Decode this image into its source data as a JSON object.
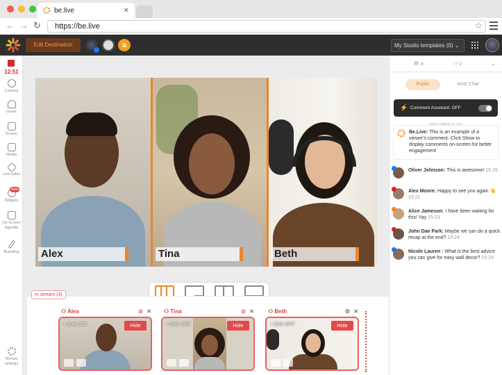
{
  "browser": {
    "tab_title": "be.live",
    "tab_close": "✕",
    "url": "https://be.live",
    "dots": [
      "#ef5b57",
      "#f6bd2f",
      "#3ec743"
    ]
  },
  "header": {
    "edit_destination": "Edit Destination",
    "studio_templates": "My Studio templates (0) ⌄",
    "accent": "#e8872d"
  },
  "sidebar": {
    "clock": "12:51",
    "items": [
      {
        "label": "Camera",
        "icon": "camera-icon"
      },
      {
        "label": "Guest",
        "icon": "guest-icon"
      },
      {
        "label": "Screen",
        "icon": "screen-icon"
      },
      {
        "label": "Media",
        "icon": "media-icon"
      },
      {
        "label": "Live Sales",
        "icon": "tag-icon"
      },
      {
        "label": "Widgets",
        "icon": "widgets-icon",
        "badge": "New"
      },
      {
        "label": "On Screen Agenda",
        "icon": "agenda-icon"
      },
      {
        "label": "Branding",
        "icon": "brush-icon"
      },
      {
        "label": "Stream settings",
        "icon": "gear-icon"
      }
    ]
  },
  "stage": {
    "cams": [
      {
        "name": "Alex"
      },
      {
        "name": "Tina"
      },
      {
        "name": "Beth"
      }
    ]
  },
  "backstage": {
    "instream": "In stream (3)",
    "guests": [
      {
        "name": "Alex",
        "solo": "• Solo OFF",
        "hide": "Hide"
      },
      {
        "name": "Tina",
        "solo": "• Solo OFF",
        "hide": "Hide"
      },
      {
        "name": "Beth",
        "solo": "• Solo OFF",
        "hide": "Hide"
      }
    ]
  },
  "panel": {
    "viewers": "👁 4",
    "guests": "⚇ 2",
    "tab_public": "Public",
    "tab_host": "Host Chat",
    "assistant": "Comment Assistant: OFF",
    "only_visible": "ONLY VISIBLE TO YOU",
    "belive_name": "Be.Live:",
    "belive_text": "This is an example of a viewer's comment. Click Show to display comments on-screen for better engagement",
    "comments": [
      {
        "name": "Oliver Johnson:",
        "text": "This is awesome!",
        "time": "15:19",
        "src": "#1877f2"
      },
      {
        "name": "Alex Moore:",
        "text": "Happy to see you again 👋",
        "time": "15:21",
        "src": "#e02020"
      },
      {
        "name": "Alice Jameson:",
        "text": "I have been waiting for this! Yay",
        "time": "15:23",
        "src": "#e8872d"
      },
      {
        "name": "John Dae Park:",
        "text": "Maybe we can do a quick recap at the end?",
        "time": "15:24",
        "src": "#e02020"
      },
      {
        "name": "Nicole Lauren :",
        "text": "What is the best advice you can give for easy wall decor?",
        "time": "15:24",
        "src": "#1877f2"
      }
    ]
  }
}
